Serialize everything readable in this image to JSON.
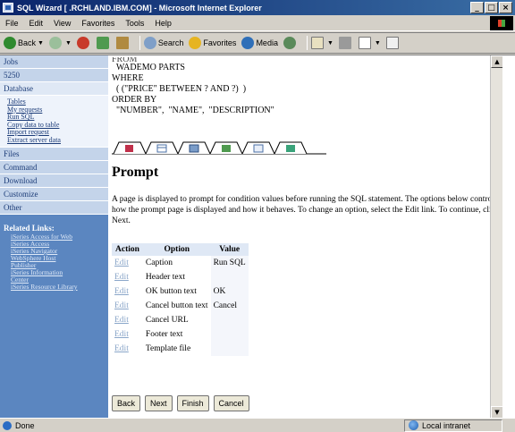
{
  "window": {
    "title": "SQL Wizard [               .RCHLAND.IBM.COM] - Microsoft Internet Explorer",
    "controls": [
      "_",
      "□",
      "×"
    ]
  },
  "menu": [
    "File",
    "Edit",
    "View",
    "Favorites",
    "Tools",
    "Help"
  ],
  "toolbar": {
    "back": "Back",
    "search": "Search",
    "favorites": "Favorites",
    "media": "Media"
  },
  "sidebar": {
    "items": [
      {
        "label": "Jobs"
      },
      {
        "label": "5250"
      },
      {
        "label": "Database"
      }
    ],
    "database_links": [
      "Tables",
      "My requests",
      "Run SQL",
      "Copy data to table",
      "Import request",
      "Extract server data"
    ],
    "items_after": [
      {
        "label": "Files"
      },
      {
        "label": "Command"
      },
      {
        "label": "Download"
      },
      {
        "label": "Customize"
      },
      {
        "label": "Other"
      }
    ],
    "related_heading": "Related Links:",
    "related_links": [
      "iSeries Access for Web",
      "iSeries Access",
      "iSeries Navigator",
      "WebSphere Host",
      "Publisher",
      "iSeries Information",
      "Center",
      "iSeries Resource Library"
    ]
  },
  "sql": {
    "lines": [
      "FROM",
      "  WADEMO PARTS",
      "WHERE",
      "  ( (\"PRICE\" BETWEEN ? AND ?)  )",
      "ORDER BY",
      "  \"NUMBER\",  \"NAME\",  \"DESCRIPTION\""
    ]
  },
  "prompt": {
    "title": "Prompt",
    "description": "A page is displayed to prompt for condition values before running the SQL statement. The options below control how the prompt page is displayed and how it behaves. To change an option, select the Edit link. To continue, click Next."
  },
  "table": {
    "headers": [
      "Action",
      "Option",
      "Value"
    ],
    "rows": [
      {
        "action": "Edit",
        "option": "Caption",
        "value": "Run SQL"
      },
      {
        "action": "Edit",
        "option": "Header text",
        "value": ""
      },
      {
        "action": "Edit",
        "option": "OK button text",
        "value": "OK"
      },
      {
        "action": "Edit",
        "option": "Cancel button text",
        "value": "Cancel"
      },
      {
        "action": "Edit",
        "option": "Cancel URL",
        "value": ""
      },
      {
        "action": "Edit",
        "option": "Footer text",
        "value": ""
      },
      {
        "action": "Edit",
        "option": "Template file",
        "value": ""
      }
    ]
  },
  "buttons": {
    "back": "Back",
    "next": "Next",
    "finish": "Finish",
    "cancel": "Cancel"
  },
  "status": {
    "left": "Done",
    "zone": "Local intranet"
  }
}
